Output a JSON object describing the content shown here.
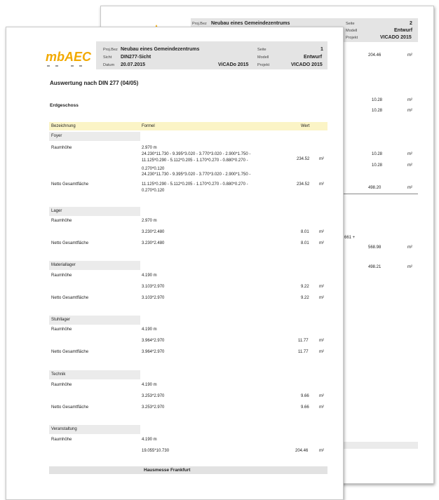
{
  "back_page": {
    "header": {
      "proj_label": "Proj.Bez",
      "proj_value": "Neubau eines Gemeindezentrums",
      "seite_label": "Seite",
      "seite_value": "2",
      "modell_label": "Modell",
      "modell_value": "Entwurf",
      "projekt_label": "Projekt",
      "projekt_value": "VICADO 2015"
    },
    "values": [
      {
        "value": "204.46",
        "unit": "m²"
      },
      {
        "value": "10.28",
        "unit": "m²"
      },
      {
        "value": "10.28",
        "unit": "m²"
      },
      {
        "value": "10.28",
        "unit": "m²"
      },
      {
        "value": "10.28",
        "unit": "m²"
      },
      {
        "value": "498.20",
        "unit": "m²"
      },
      {
        "value": "568.98",
        "unit": "m²"
      },
      {
        "value": "498.21",
        "unit": "m²"
      }
    ],
    "fragment": "661 +"
  },
  "front_page": {
    "logo_text": "mbAEC",
    "header": {
      "proj_label": "Proj.Bez",
      "proj_value": "Neubau eines Gemeindezentrums",
      "sicht_label": "Sicht",
      "sicht_value": "DIN277-Sicht",
      "datum_label": "Datum",
      "datum_value": "20.07.2015",
      "software": "ViCADo 2015",
      "seite_label": "Seite",
      "seite_value": "1",
      "modell_label": "Modell",
      "modell_value": "Entwurf",
      "projekt_label": "Projekt",
      "projekt_value": "VICADO 2015"
    },
    "title": "Auswertung nach DIN 277 (04/05)",
    "floor": "Erdgeschoss",
    "columns": {
      "bezeichnung": "Bezeichnung",
      "formel": "Formel",
      "wert": "Wert"
    },
    "footer": "Hausmesse Frankfurt",
    "foyer": {
      "name": "Foyer",
      "raumhoehe_label": "Raumhöhe",
      "raumhoehe_value": "2.970 m",
      "formula1_l1": "24.230*11.730 - 9.395*3.020 - 3.770*3.020 - 2.900*1.750 -",
      "formula1_l2": "11.125*0.290 - 5.112*0.205 - 1.170*0.270 - 0.880*0.270 -",
      "formula1_l3": "0.270*0.120",
      "value1": "234.52",
      "netto_label": "Netto Gesamtfläche",
      "formula2_l1": "24.230*11.730 - 9.395*3.020 - 3.770*3.020 - 2.900*1.750 -",
      "formula2_l2": "11.125*0.290 - 5.112*0.205 - 1.170*0.270 - 0.880*0.270 -",
      "formula2_l3": "0.270*0.120",
      "value2": "234.52",
      "unit": "m²"
    },
    "rooms": [
      {
        "name": "Lager",
        "raumhoehe_label": "Raumhöhe",
        "raumhoehe_value": "2.970 m",
        "formula": "3.230*2.480",
        "value": "8.01",
        "netto_label": "Netto Gesamtfläche",
        "netto_formula": "3.230*2.480",
        "netto_value": "8.01",
        "unit": "m²"
      },
      {
        "name": "Materiallager",
        "raumhoehe_label": "Raumhöhe",
        "raumhoehe_value": "4.190 m",
        "formula": "3.103*2.970",
        "value": "9.22",
        "netto_label": "Netto Gesamtfläche",
        "netto_formula": "3.103*2.970",
        "netto_value": "9.22",
        "unit": "m²"
      },
      {
        "name": "Stuhllager",
        "raumhoehe_label": "Raumhöhe",
        "raumhoehe_value": "4.190 m",
        "formula": "3.964*2.970",
        "value": "11.77",
        "netto_label": "Netto Gesamtfläche",
        "netto_formula": "3.964*2.970",
        "netto_value": "11.77",
        "unit": "m²"
      },
      {
        "name": "Technik",
        "raumhoehe_label": "Raumhöhe",
        "raumhoehe_value": "4.190 m",
        "formula": "3.253*2.970",
        "value": "9.66",
        "netto_label": "Netto Gesamtfläche",
        "netto_formula": "3.253*2.970",
        "netto_value": "9.66",
        "unit": "m²"
      }
    ],
    "veranstaltung": {
      "name": "Veranstaltung",
      "raumhoehe_label": "Raumhöhe",
      "raumhoehe_value": "4.190 m",
      "formula": "19.055*10.730",
      "value": "204.46",
      "unit": "m²"
    }
  }
}
